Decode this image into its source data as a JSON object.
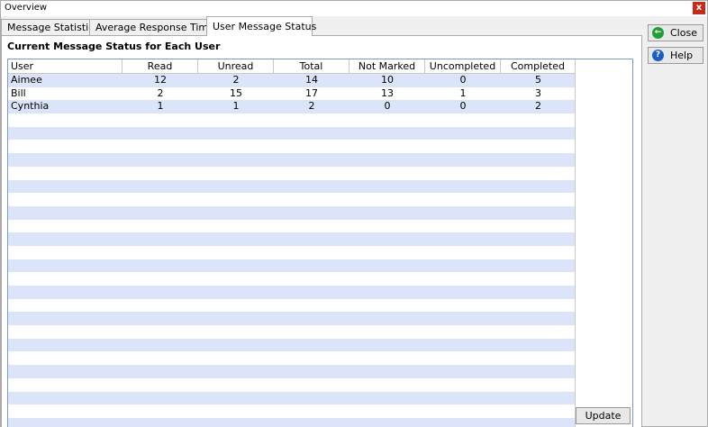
{
  "window": {
    "title": "Overview",
    "close_glyph": "x"
  },
  "tabs": [
    {
      "label": "Message Statistics",
      "active": false
    },
    {
      "label": "Average Response Times",
      "active": false
    },
    {
      "label": "User Message Status",
      "active": true
    }
  ],
  "section_title": "Current Message Status for Each User",
  "table": {
    "columns": [
      "User",
      "Read",
      "Unread",
      "Total",
      "Not Marked",
      "Uncompleted",
      "Completed"
    ],
    "rows": [
      [
        "Aimee",
        "12",
        "2",
        "14",
        "10",
        "0",
        "5"
      ],
      [
        "Bill",
        "2",
        "15",
        "17",
        "13",
        "1",
        "3"
      ],
      [
        "Cynthia",
        "1",
        "1",
        "2",
        "0",
        "0",
        "2"
      ]
    ],
    "empty_rows": 25,
    "alt_row_color": "#dce4fa"
  },
  "buttons": {
    "close": {
      "label": "Close",
      "icon": "back-arrow-icon",
      "icon_color": "#1f9e3a"
    },
    "help": {
      "label": "Help",
      "icon": "question-icon",
      "icon_color": "#1c5ec7"
    },
    "update": {
      "label": "Update"
    }
  }
}
